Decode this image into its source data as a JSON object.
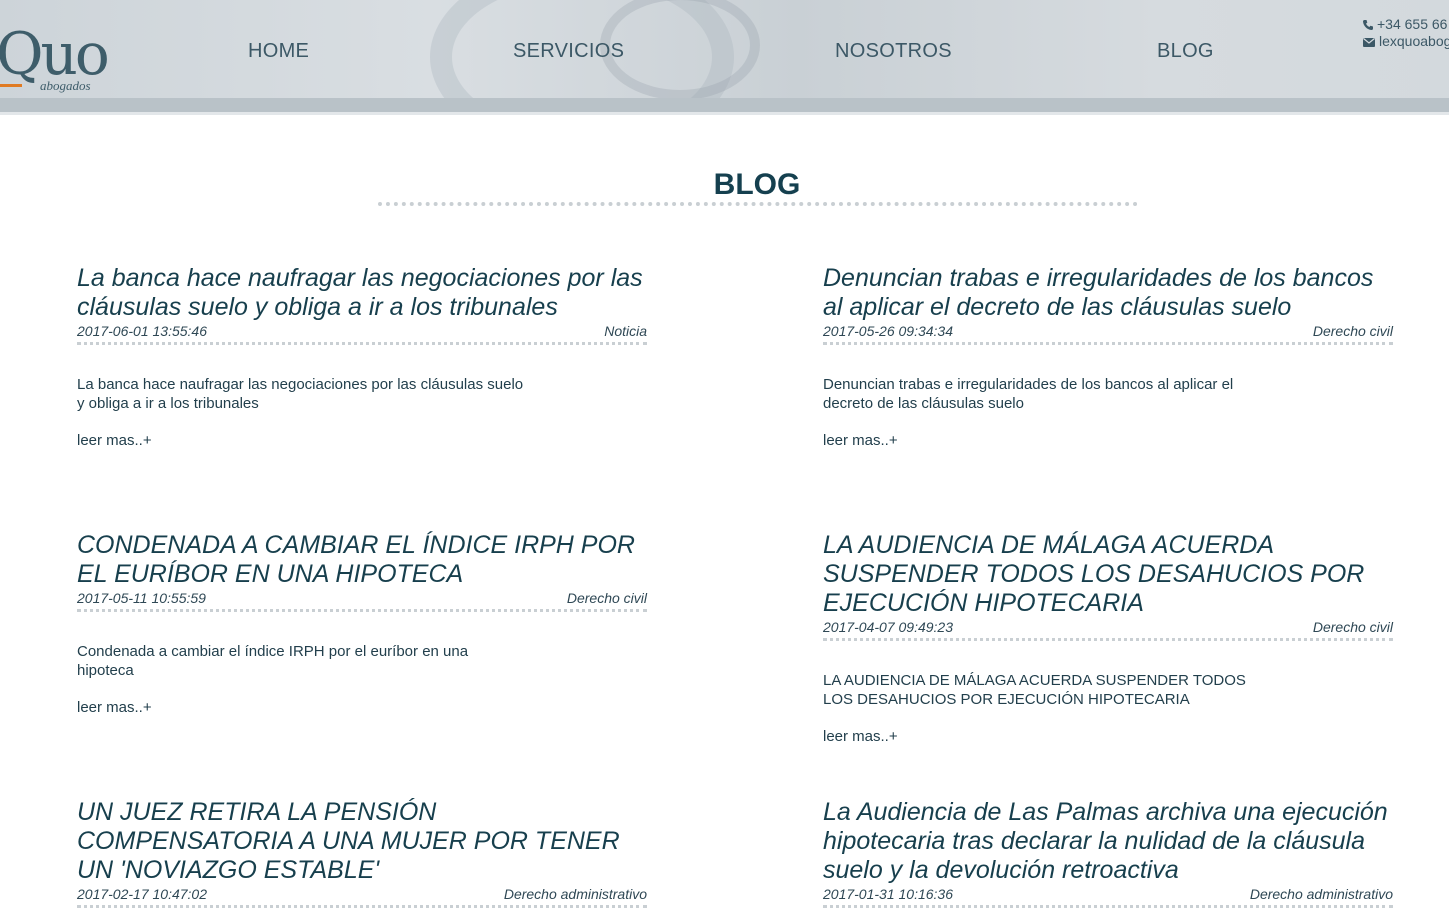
{
  "logo": {
    "main": "Quo",
    "sub": "abogados"
  },
  "nav": [
    "HOME",
    "SERVICIOS",
    "NOSOTROS",
    "BLOG"
  ],
  "contact": {
    "phone": "+34 655 66",
    "email": "lexquoabog"
  },
  "page_title": "BLOG",
  "posts": [
    {
      "title": "La banca hace naufragar las negociaciones por las cláusulas suelo y obliga a ir a los tribunales",
      "date": "2017-06-01 13:55:46",
      "category": "Noticia",
      "excerpt": "La banca hace naufragar las negociaciones por las cláusulas suelo y obliga a ir a los tribunales",
      "more": "leer mas..+"
    },
    {
      "title": "Denuncian trabas e irregularidades de los bancos al aplicar el decreto de las cláusulas suelo",
      "date": "2017-05-26 09:34:34",
      "category": "Derecho civil",
      "excerpt": "Denuncian trabas e irregularidades de los bancos al aplicar el decreto de las cláusulas suelo",
      "more": "leer mas..+"
    },
    {
      "title": "CONDENADA A CAMBIAR EL ÍNDICE IRPH POR EL EURÍBOR EN UNA HIPOTECA",
      "date": "2017-05-11 10:55:59",
      "category": "Derecho civil",
      "excerpt": "Condenada a cambiar el índice IRPH por el euríbor en una hipoteca",
      "more": "leer mas..+"
    },
    {
      "title": "LA AUDIENCIA DE MÁLAGA ACUERDA SUSPENDER TODOS LOS DESAHUCIOS POR EJECUCIÓN HIPOTECARIA",
      "date": "2017-04-07 09:49:23",
      "category": "Derecho civil",
      "excerpt": "LA AUDIENCIA DE MÁLAGA ACUERDA SUSPENDER TODOS LOS DESAHUCIOS POR EJECUCIÓN HIPOTECARIA",
      "more": "leer mas..+"
    },
    {
      "title": "UN JUEZ RETIRA LA PENSIÓN COMPENSATORIA A UNA MUJER POR TENER UN 'NOVIAZGO ESTABLE'",
      "date": "2017-02-17 10:47:02",
      "category": "Derecho administrativo"
    },
    {
      "title": "La Audiencia de Las Palmas archiva una ejecución hipotecaria tras declarar la nulidad de la cláusula suelo y la devolución retroactiva",
      "date": "2017-01-31 10:16:36",
      "category": "Derecho administrativo"
    }
  ]
}
